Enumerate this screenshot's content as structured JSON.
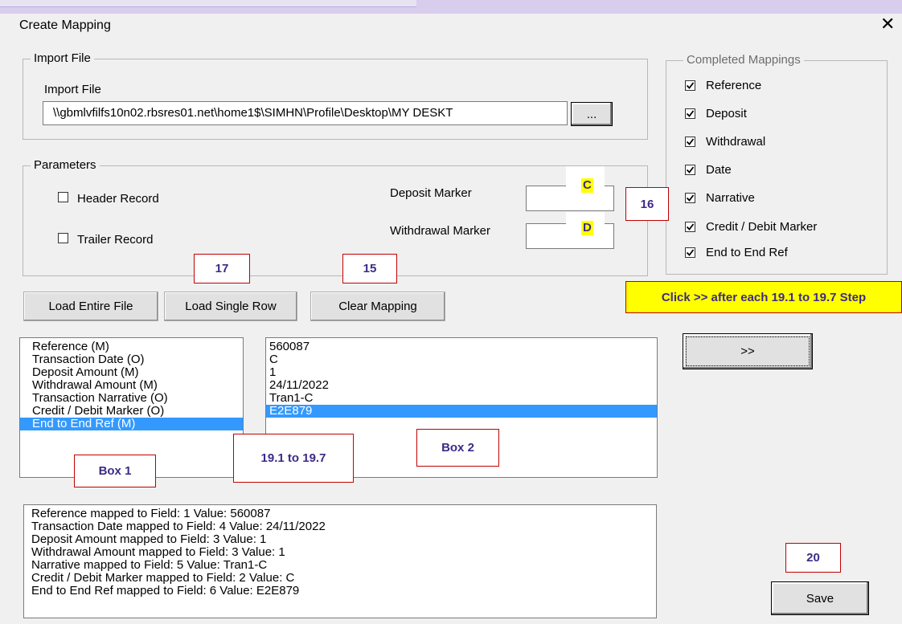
{
  "dialog": {
    "title": "Create Mapping",
    "close_glyph": "✕"
  },
  "import_group": {
    "legend": "Import File",
    "field_label": "Import File",
    "path_value": "\\\\gbmlvfilfs10n02.rbsres01.net\\home1$\\SIMHN\\Profile\\Desktop\\MY DESKT",
    "browse_label": "..."
  },
  "parameters_group": {
    "legend": "Parameters",
    "header_record_label": "Header Record",
    "trailer_record_label": "Trailer Record",
    "deposit_marker_label": "Deposit Marker",
    "withdrawal_marker_label": "Withdrawal Marker",
    "deposit_marker_value": "C",
    "withdrawal_marker_value": "D"
  },
  "completed_group": {
    "legend": "Completed Mappings",
    "items": [
      {
        "label": "Reference",
        "checked": true
      },
      {
        "label": "Deposit",
        "checked": true
      },
      {
        "label": "Withdrawal",
        "checked": true
      },
      {
        "label": "Date",
        "checked": true
      },
      {
        "label": "Narrative",
        "checked": true
      },
      {
        "label": "Credit / Debit Marker",
        "checked": true
      },
      {
        "label": "End to End Ref",
        "checked": true
      }
    ]
  },
  "buttons": {
    "load_entire": "Load Entire File",
    "load_single": "Load Single Row",
    "clear_mapping": "Clear Mapping",
    "map_next": ">>",
    "save": "Save"
  },
  "box1": {
    "items": [
      "Reference (M)",
      "Transaction Date (O)",
      "Deposit Amount (M)",
      "Withdrawal Amount (M)",
      "Transaction Narrative (O)",
      "Credit / Debit Marker (O)",
      "End to End Ref (M)"
    ],
    "selected_index": 6
  },
  "box2": {
    "items": [
      "560087",
      "C",
      "1",
      "24/11/2022",
      "Tran1-C",
      "E2E879"
    ],
    "selected_index": 5
  },
  "log": {
    "lines": [
      "Reference mapped to Field: 1 Value: 560087",
      "Transaction Date mapped to Field: 4 Value: 24/11/2022",
      "Deposit Amount mapped to Field: 3 Value: 1",
      "Withdrawal Amount mapped to Field: 3 Value: 1",
      "Narrative mapped to Field: 5 Value: Tran1-C",
      "Credit / Debit Marker mapped to Field: 2 Value: C",
      "End to End Ref mapped to Field: 6 Value: E2E879"
    ]
  },
  "annotations": {
    "step16": "16",
    "step17": "17",
    "step15": "15",
    "step20": "20",
    "step19": "19.1 to 19.7",
    "box1_label": "Box 1",
    "box2_label": "Box 2",
    "instruction": "Click >> after each 19.1 to  19.7 Step"
  },
  "colors": {
    "selection": "#3399ff",
    "annotation_border": "#c00000",
    "annotation_text": "#3d2a86",
    "highlight": "#ffff00"
  }
}
